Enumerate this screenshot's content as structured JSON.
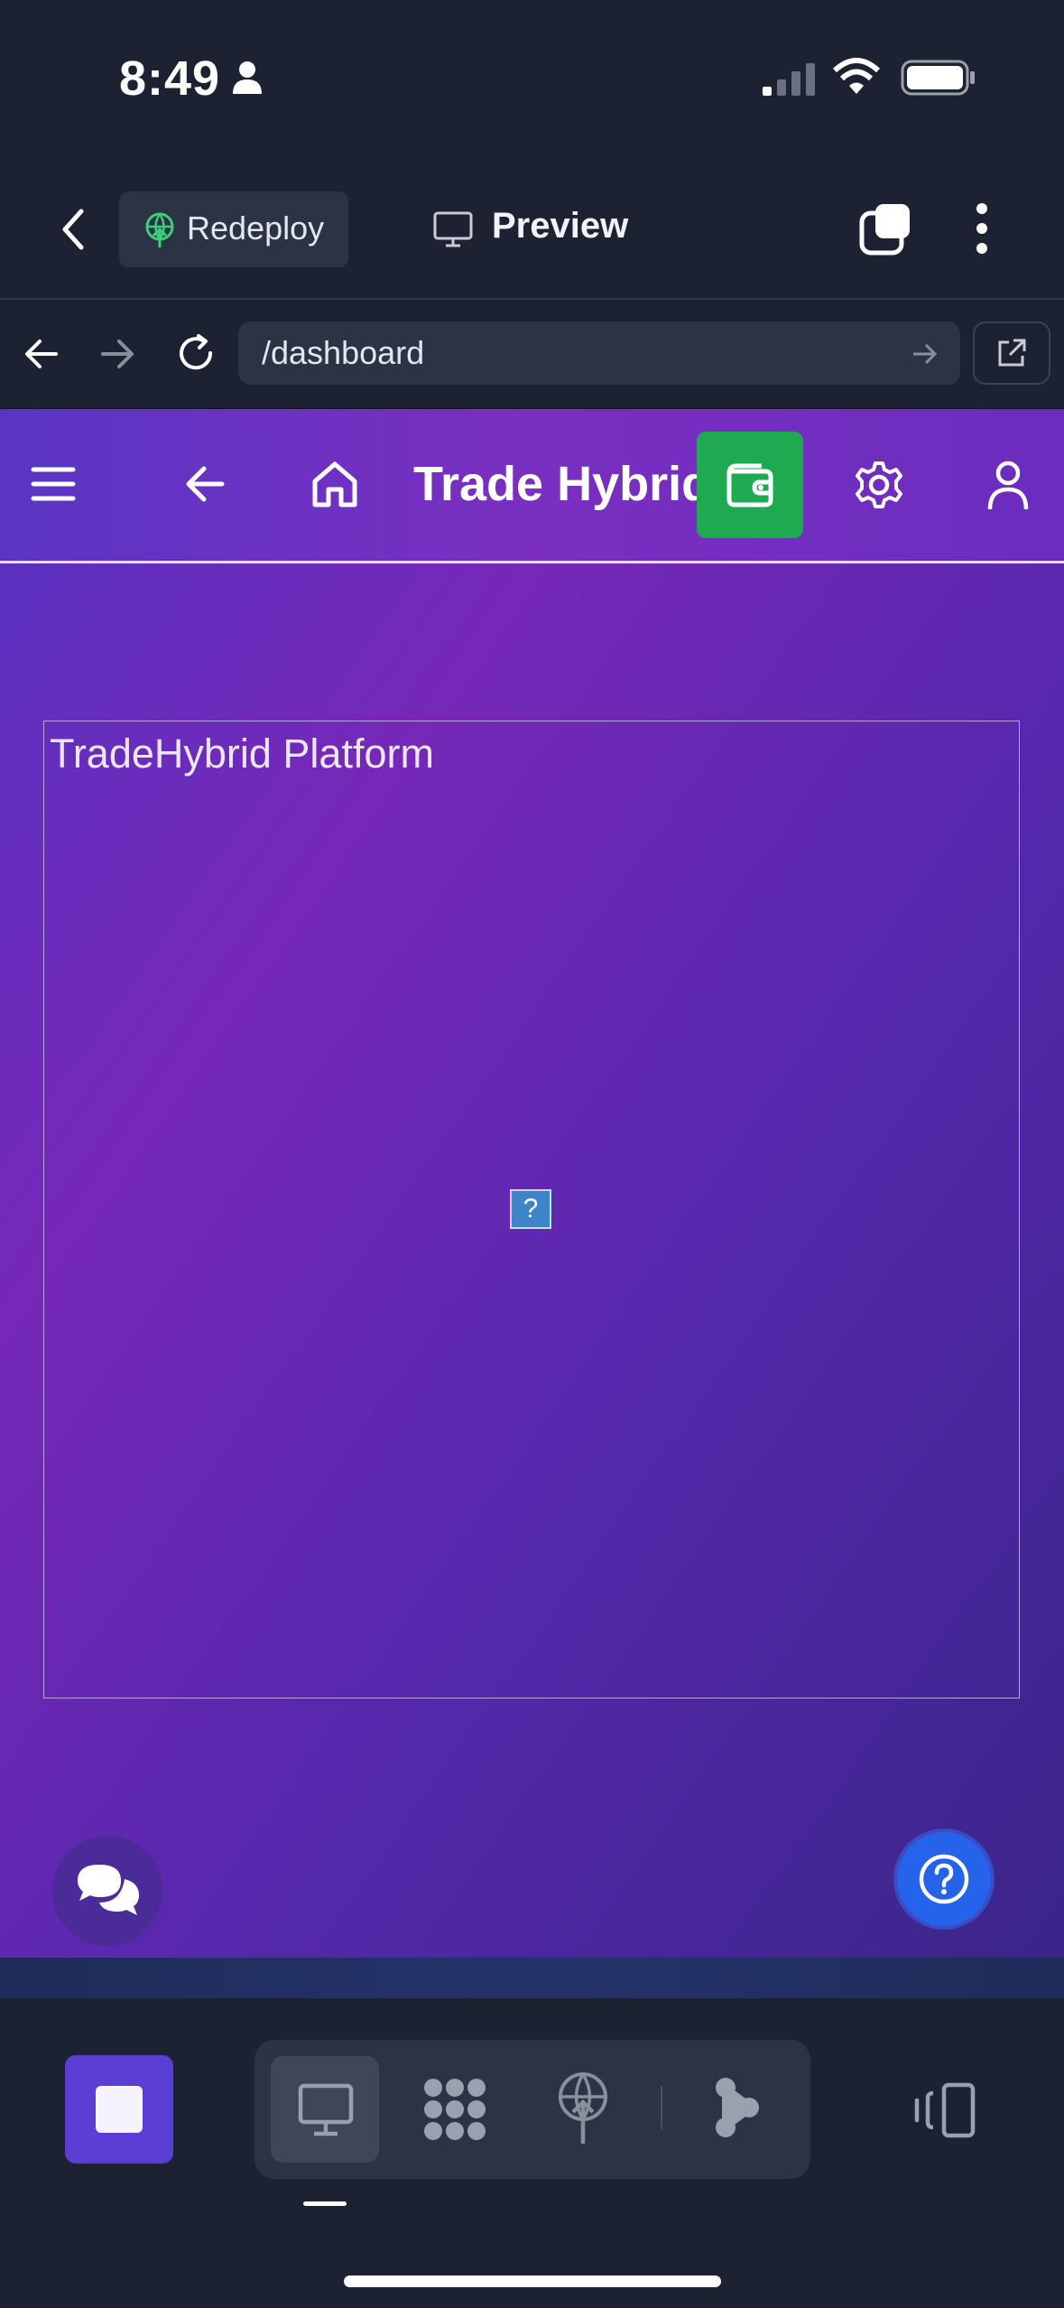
{
  "status_bar": {
    "time": "8:49",
    "icons": [
      "person-icon",
      "cellular-signal-icon",
      "wifi-icon",
      "battery-icon"
    ]
  },
  "toolbar": {
    "back_icon": "chevron-left-icon",
    "redeploy_label": "Redeploy",
    "preview_label": "Preview",
    "icons": [
      "deploy-icon",
      "monitor-icon",
      "tabs-icon",
      "more-vertical-icon"
    ]
  },
  "url_bar": {
    "path": "/dashboard",
    "icons": [
      "back-arrow-icon",
      "forward-arrow-icon",
      "reload-icon",
      "go-arrow-icon",
      "external-link-icon"
    ]
  },
  "webpage": {
    "navbar": {
      "title": "Trade Hybrid",
      "icons": [
        "menu-icon",
        "back-arrow-icon",
        "home-icon",
        "wallet-icon",
        "gear-icon",
        "user-icon"
      ],
      "wallet_color": "#1faa52"
    },
    "frame_title": "TradeHybrid Platform",
    "broken_image_glyph": "?",
    "chat_icon": "chat-bubbles-icon",
    "help_icon": "help-circle-icon",
    "gradient": [
      "#5633c2",
      "#7628b8",
      "#3a2589"
    ]
  },
  "bottom_bar": {
    "stop_icon": "stop-icon",
    "tabs": [
      "monitor-icon",
      "workspace-icon",
      "deploy-icon",
      "branch-icon"
    ],
    "active_tab": "monitor-icon",
    "right_icon": "devices-icon",
    "accent": "#5b3fd4"
  }
}
